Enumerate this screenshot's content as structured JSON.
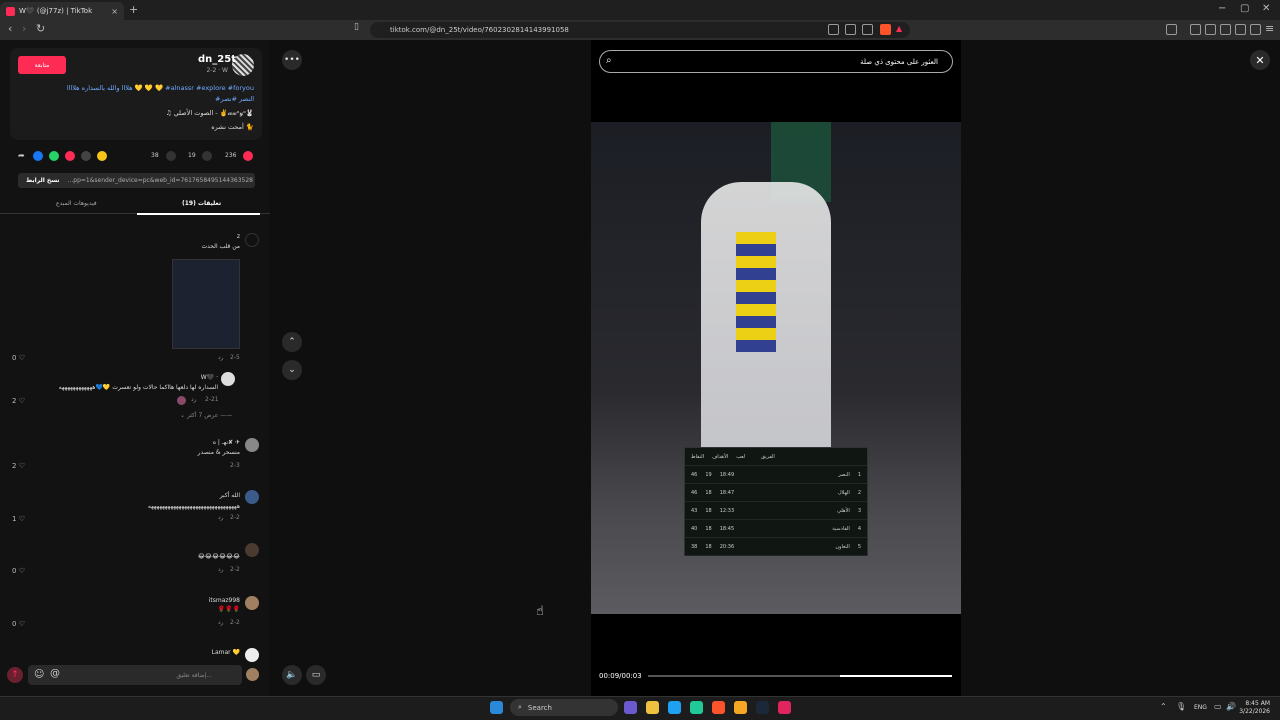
{
  "browser": {
    "tab_title": "W🖤 (@j77z) | TikTok",
    "tab_close": "×",
    "new_tab": "+",
    "url": "tiktok.com/@dn_25t/video/7602302814143991058",
    "win_min": "−",
    "win_max": "▢",
    "win_close": "✕"
  },
  "post": {
    "follow_label": "متابعة",
    "username": "dn_25t",
    "date": "2-2 · W",
    "caption_line1": "هلااا والله بالسداره هلاااا 💛 💛 💛 #alnassr #explore #foryou",
    "caption_line2": "#النصر #نصر",
    "sound_line": "♫ الصوت الأصلي - ✌️𝓌𝓌ᵒ𝓎ᵒ🐰",
    "author_line": "أمحت نشره 🐈"
  },
  "actions": {
    "likes": "236",
    "comments": "19",
    "saves": "38"
  },
  "link": {
    "copy_label": "نسخ الرابط",
    "text": "...pp=1&sender_device=pc&web_id=7617658495144363528"
  },
  "tabs": {
    "creator_videos": "فيديوهات المبدع",
    "comments": "(19) تعليقات"
  },
  "comments": [
    {
      "name": "z",
      "text": "من قلب الحدث",
      "date": "2-5",
      "reply": "رد",
      "likes": "0"
    },
    {
      "name": "W🖤 ·",
      "text": "السداره لها دلعها هااكما حالات ولو تعسرت 💛💙ههههههههههههه",
      "date": "2-21",
      "reply": "رد",
      "likes": "2",
      "more_replies": "عرض 7 أكثر"
    },
    {
      "name": "نهـ | ه✘ ✈",
      "text": "منسحر & منصدر",
      "date": "2-3",
      "reply": "",
      "likes": "2"
    },
    {
      "name": "الله أكبر",
      "text": "ههههههههههههههههههههههههههههههههه",
      "date": "2-2",
      "reply": "رد",
      "likes": "1"
    },
    {
      "name": "",
      "text": "😂😂😂😂😂😂",
      "date": "2-2",
      "reply": "رد",
      "likes": "0"
    },
    {
      "name": "itsmaz998",
      "text": "🌹🌹🌹",
      "date": "2-2",
      "reply": "رد",
      "likes": "0"
    },
    {
      "name": "Lamar 💛",
      "text": "",
      "date": "",
      "reply": "",
      "likes": ""
    }
  ],
  "comment_input": {
    "placeholder": "إضافة تعليق..."
  },
  "video": {
    "search_placeholder": "العثور على محتوى ذي صلة",
    "time": "00:09/00:03",
    "progress": 0.37,
    "table_headers": [
      "النقاط",
      "الأهداف",
      "لعب",
      "",
      "الفريق"
    ],
    "table_rows": [
      {
        "pos": "1",
        "team": "النصر",
        "played": "19",
        "goals": "18:49",
        "points": "46"
      },
      {
        "pos": "2",
        "team": "الهلال",
        "played": "18",
        "goals": "18:47",
        "points": "46"
      },
      {
        "pos": "3",
        "team": "الأهلي",
        "played": "18",
        "goals": "12:33",
        "points": "43"
      },
      {
        "pos": "4",
        "team": "القادسية",
        "played": "18",
        "goals": "18:45",
        "points": "40"
      },
      {
        "pos": "5",
        "team": "التعاون",
        "played": "18",
        "goals": "20:36",
        "points": "38"
      }
    ]
  },
  "taskbar": {
    "search_label": "Search",
    "lang": "ENG",
    "time": "8:45 AM",
    "date": "3/22/2026"
  }
}
